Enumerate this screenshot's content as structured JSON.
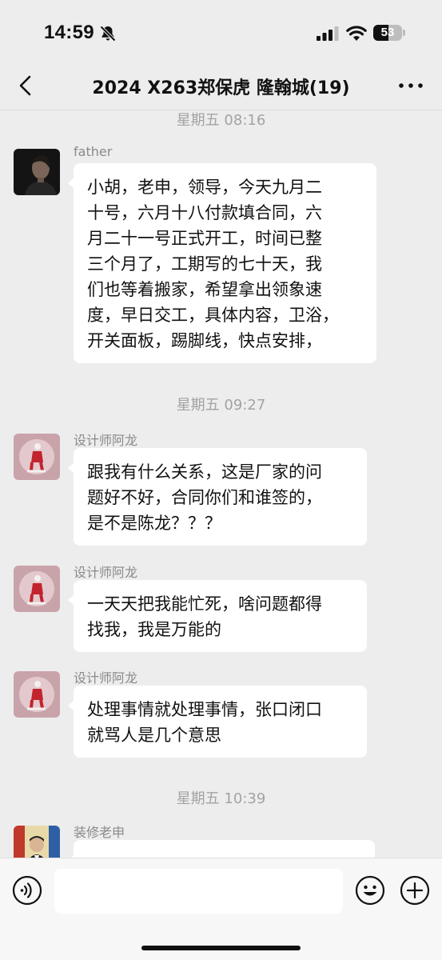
{
  "status_bar": {
    "time": "14:59",
    "battery_level": "53",
    "battery_fraction": 0.53,
    "icons": [
      "bell-off-icon",
      "cellular-signal-icon",
      "wifi-icon",
      "battery-icon"
    ]
  },
  "header": {
    "title": "2024 X263郑保虎 隆翰城(19)",
    "back_icon": "chevron-left-icon",
    "more_icon": "more-dots-icon"
  },
  "timestamps": [
    "星期五 08:16",
    "星期五 09:27",
    "星期五 10:39"
  ],
  "messages": [
    {
      "sender": "father",
      "text": "小胡，老申，领导，今天九月二\n十号，六月十八付款填合同，六\n月二十一号正式开工，时间已整\n三个月了，工期写的七十天，我\n们也等着搬家，希望拿出领象速\n度，早日交工，具体内容，卫浴，\n开关面板，踢脚线，快点安排，"
    },
    {
      "sender": "设计师阿龙",
      "text": "跟我有什么关系，这是厂家的问\n题好不好，合同你们和谁签的，\n是不是陈龙？？？"
    },
    {
      "sender": "设计师阿龙",
      "text": "一天天把我能忙死，啥问题都得\n找我，我是万能的"
    },
    {
      "sender": "设计师阿龙",
      "text": "处理事情就处理事情，张口闭口\n就骂人是几个意思"
    },
    {
      "sender": "装修老申",
      "text": ""
    }
  ],
  "input_bar": {
    "placeholder": "",
    "icons": [
      "voice-icon",
      "emoji-icon",
      "plus-icon"
    ]
  },
  "colors": {
    "background": "#ededed",
    "bubble": "#ffffff",
    "timestamp": "#a3a3a3",
    "sender_name": "#8a8a8a"
  }
}
